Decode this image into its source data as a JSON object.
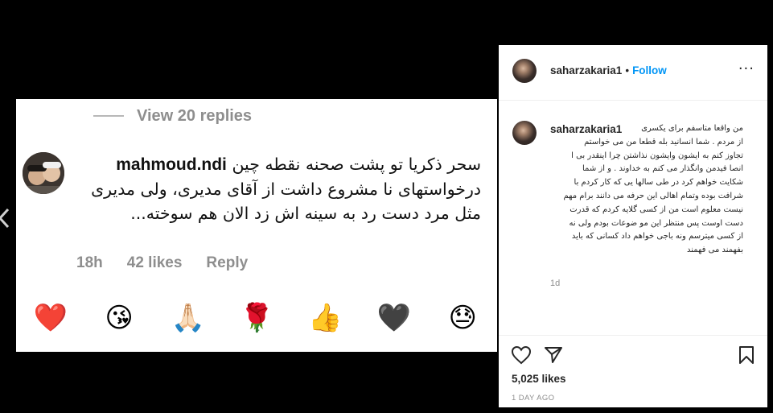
{
  "comment": {
    "view_replies": "View 20 replies",
    "username": "mahmoud.ndi",
    "text_line1": "سحر ذکریا تو پشت صحنه نقطه چین",
    "text_rest": "درخواستهای نا مشروع داشت از آقای مدیری، ولی مدیری مثل مرد دست رد به سینه اش زد الان هم سوخته...",
    "time": "18h",
    "likes": "42 likes",
    "reply": "Reply"
  },
  "reactions": [
    "❤️",
    "😘",
    "🙏🏻",
    "🌹",
    "👍",
    "🖤",
    "😓"
  ],
  "reaction_names": [
    "red-heart",
    "kiss",
    "praying-hands",
    "rose",
    "thumbs-up",
    "black-heart",
    "downcast-sweat"
  ],
  "post": {
    "username": "saharzakaria1",
    "dot": "•",
    "follow": "Follow",
    "more": "···",
    "caption_user": "saharzakaria1",
    "caption_lines": [
      "من واقعا متاسفم برای یکسری",
      "از مردم . شما انسانید بله قطعا من می خواستم",
      "تجاوز کنم به ایشون وایشون نذاشتن چرا اینقدر بی ا",
      "انصا فیدمن وانگذار می کنم به خداوند . و از شما",
      "شکایت خواهم کرد در طی سالها یی که کار کردم با",
      "شرافت بوده وتمام اهالی این حرفه می دانند برام مهم",
      "نیست معلوم است من از کسی گلایه کردم که قدرت",
      "دست اوست پس منتظر این مو ضوعات بودم ولی نه",
      "از کسی میترسم ونه باجی خواهم داد کسانی که باید",
      "بفهمند می فهمند"
    ],
    "caption_time": "1d",
    "likes": "5,025 likes",
    "date": "1 DAY AGO"
  },
  "colors": {
    "background": "#000000",
    "follow": "#0095f6",
    "muted": "#8e8e8e",
    "text": "#262626"
  }
}
